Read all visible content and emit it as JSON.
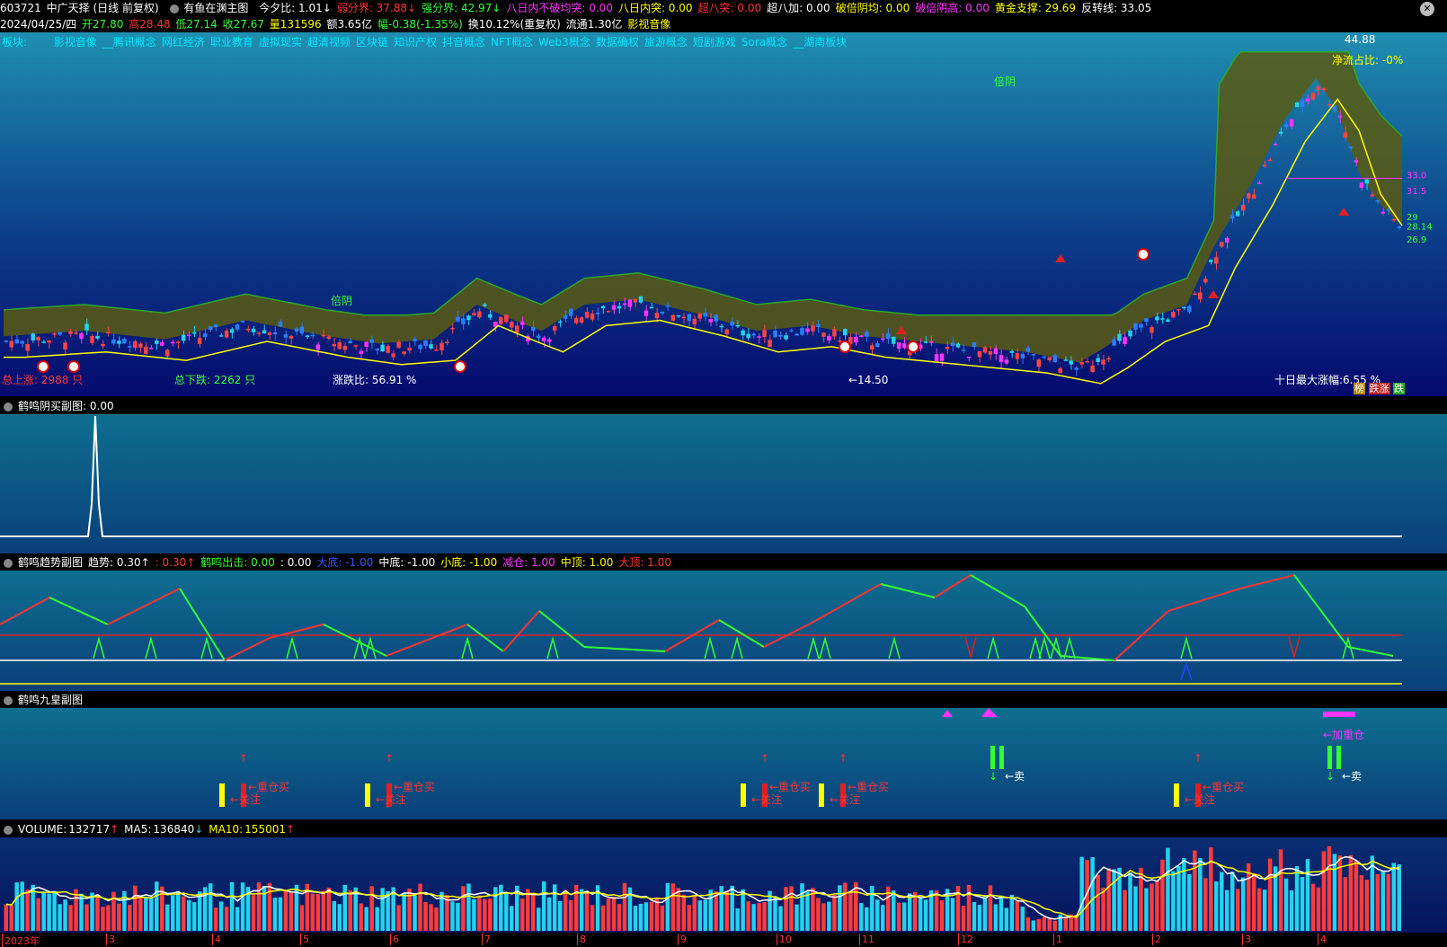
{
  "row1": {
    "code": "603721",
    "name": "中广天择",
    "mode": "(日线 前复权)",
    "formula": "有鱼在渊主图",
    "items": [
      {
        "label": "今夕比:",
        "value": "1.01",
        "arrow": "↓",
        "color": "#ffffff"
      },
      {
        "label": "弱分界:",
        "value": "37.88",
        "arrow": "↓",
        "color": "#ff3333"
      },
      {
        "label": "强分界:",
        "value": "42.97",
        "arrow": "↓",
        "color": "#33ff33"
      },
      {
        "label": "八日内不破均突:",
        "value": "0.00",
        "arrow": "",
        "color": "#ff33ff"
      },
      {
        "label": "八日内突:",
        "value": "0.00",
        "arrow": "",
        "color": "#ffff00"
      },
      {
        "label": "超八突:",
        "value": "0.00",
        "arrow": "",
        "color": "#ff3333"
      },
      {
        "label": "超八加:",
        "value": "0.00",
        "arrow": "",
        "color": "#ffffff"
      },
      {
        "label": "破倍阴均:",
        "value": "0.00",
        "arrow": "",
        "color": "#ffff00"
      },
      {
        "label": "破倍阴高:",
        "value": "0.00",
        "arrow": "",
        "color": "#ff33ff"
      },
      {
        "label": "黄金支撑:",
        "value": "29.69",
        "arrow": "",
        "color": "#ffff00"
      },
      {
        "label": "反转线:",
        "value": "33.05",
        "arrow": "",
        "color": "#ffffff"
      }
    ]
  },
  "row2": {
    "date": "2024/04/25/四",
    "open": "开27.80",
    "high": "高28.48",
    "low": "低27.14",
    "close": "收27.67",
    "vol": "量131596",
    "amount": "额3.65亿",
    "change": "幅-0.38(-1.35%)",
    "turnover": "换10.12%(重复权)",
    "float": "流通1.30亿",
    "sector": "影视音像"
  },
  "sectors": {
    "label": "板块:",
    "list": [
      "影视音像",
      "__腾讯概念",
      "网红经济",
      "职业教育",
      "虚拟现实",
      "超清视频",
      "区块链",
      "知识产权",
      "抖音概念",
      "NFT概念",
      "Web3概念",
      "数据确权",
      "旅游概念",
      "短剧游戏",
      "Sora概念",
      "__湖南板块"
    ]
  },
  "main_chart": {
    "price_high": "44.88",
    "price_low": "←14.50",
    "net_flow": "净流占比: -0%",
    "total_up": "总上涨: 2988 只",
    "total_down": "总下跌: 2262 只",
    "ratio": "涨跌比: 56.91 %",
    "max_gain": "十日最大涨幅:6.55 %",
    "beiyin": "倍阴",
    "right_labels": [
      "33",
      "33.0",
      "31.5",
      "29",
      "28.14",
      "26.9"
    ],
    "tags": [
      "榜",
      "跌涨",
      "跌"
    ]
  },
  "sub1": {
    "title": "鹤鸣阴买副图",
    "value": ": 0.00"
  },
  "sub2": {
    "title": "鹤鸣趋势副图",
    "items": [
      {
        "label": "趋势:",
        "value": "0.30",
        "arrow": "↑",
        "color": "#ffffff"
      },
      {
        "label": ":",
        "value": "0.30",
        "arrow": "↑",
        "color": "#ff3333"
      },
      {
        "label": "鹤鸣出击:",
        "value": "0.00",
        "arrow": "",
        "color": "#33ff33"
      },
      {
        "label": ":",
        "value": "0.00",
        "arrow": "",
        "color": "#ffffff"
      },
      {
        "label": "大底:",
        "value": "-1.00",
        "arrow": "",
        "color": "#3355ff"
      },
      {
        "label": "中底:",
        "value": "-1.00",
        "arrow": "",
        "color": "#ffffff"
      },
      {
        "label": "小底:",
        "value": "-1.00",
        "arrow": "",
        "color": "#ffff00"
      },
      {
        "label": "减仓:",
        "value": "1.00",
        "arrow": "",
        "color": "#ff33ff"
      },
      {
        "label": "中顶:",
        "value": "1.00",
        "arrow": "",
        "color": "#ffff00"
      },
      {
        "label": "大顶:",
        "value": "1.00",
        "arrow": "",
        "color": "#ff3333"
      }
    ]
  },
  "sub3": {
    "title": "鹤鸣九皇副图",
    "labels": {
      "guanzhu": "关注",
      "zhongcang": "重仓买",
      "mai": "卖",
      "jiazhong": "加重仓"
    }
  },
  "volume": {
    "title": "VOLUME:",
    "value": "132717",
    "ma5_label": "MA5:",
    "ma5": "136840",
    "ma10_label": "MA10:",
    "ma10": "155001"
  },
  "xaxis": [
    "2023年",
    "3",
    "4",
    "5",
    "6",
    "7",
    "8",
    "9",
    "10",
    "11",
    "12",
    "1",
    "2",
    "3",
    "4"
  ],
  "colors": {
    "up": "#ff3b3b",
    "down": "#22d3ee",
    "ma5": "#ffffff",
    "ma10": "#ffff00"
  }
}
